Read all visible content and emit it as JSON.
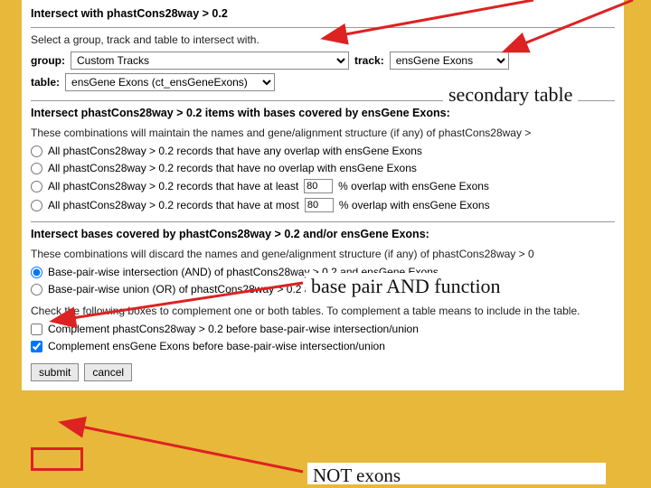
{
  "header": {
    "title": "Intersect with phastCons28way > 0.2",
    "instr": "Select a group, track and table to intersect with."
  },
  "selects": {
    "group_label": "group:",
    "group_value": "Custom Tracks",
    "track_label": "track:",
    "track_value": "ensGene Exons",
    "table_label": "table:",
    "table_value": "ensGene Exons (ct_ensGeneExons)"
  },
  "sect2": {
    "title": "Intersect phastCons28way > 0.2 items with bases covered by ensGene Exons:",
    "instr": "These combinations will maintain the names and gene/alignment structure (if any) of phastCons28way > ",
    "opt1": "All phastCons28way > 0.2 records that have any overlap with ensGene Exons",
    "opt2": "All phastCons28way > 0.2 records that have no overlap with ensGene Exons",
    "opt3a": "All phastCons28way > 0.2 records that have at least",
    "opt3b": "% overlap with ensGene Exons",
    "opt3v": "80",
    "opt4a": "All phastCons28way > 0.2 records that have at most",
    "opt4b": "% overlap with ensGene Exons",
    "opt4v": "80"
  },
  "sect3": {
    "title": "Intersect bases covered by phastCons28way > 0.2 and/or ensGene Exons:",
    "instr": "These combinations will discard the names and gene/alignment structure (if any) of phastCons28way > 0",
    "opt1": "Base-pair-wise intersection (AND) of phastCons28way > 0.2 and ensGene Exons",
    "opt2": "Base-pair-wise union (OR) of phastCons28way > 0.2 and ensGene Exons",
    "note": "Check the following boxes to complement one or both tables. To complement a table means to include in the table.",
    "chk1": "Complement phastCons28way > 0.2 before base-pair-wise intersection/union",
    "chk2": "Complement ensGene Exons before base-pair-wise intersection/union"
  },
  "buttons": {
    "submit": "submit",
    "cancel": "cancel"
  },
  "callouts": {
    "secondary": "secondary table",
    "basepair": "base pair AND function",
    "notexons": "NOT exons"
  }
}
